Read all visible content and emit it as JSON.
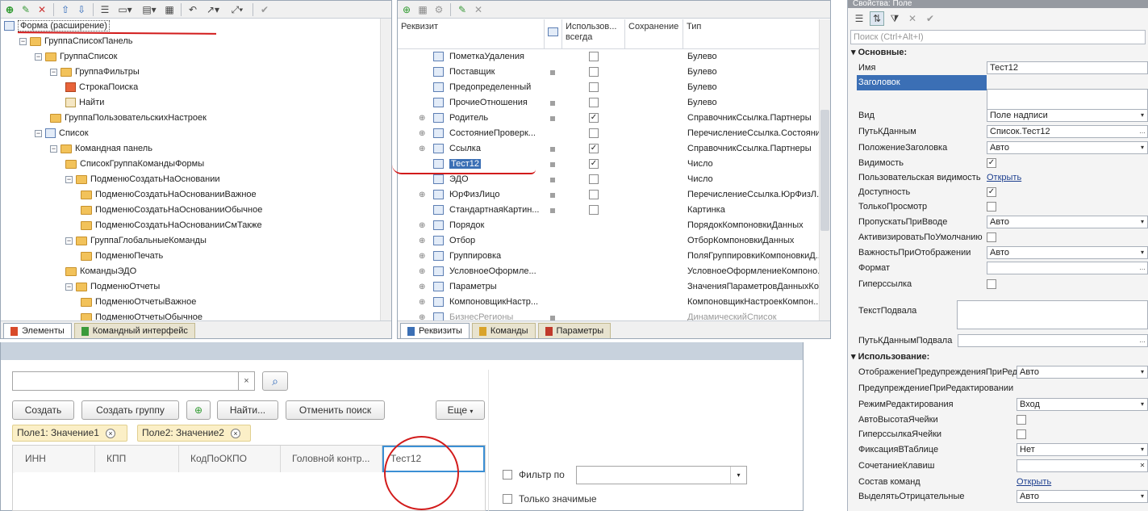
{
  "left_panel": {
    "tree": [
      {
        "label": "Форма (расширение)",
        "level": 0
      },
      {
        "label": "ГруппаСписокПанель",
        "level": 1
      },
      {
        "label": "ГруппаСписок",
        "level": 2
      },
      {
        "label": "ГруппаФильтры",
        "level": 3
      },
      {
        "label": "СтрокаПоиска",
        "level": 4
      },
      {
        "label": "Найти",
        "level": 4
      },
      {
        "label": "ГруппаПользовательскихНастроек",
        "level": 3
      },
      {
        "label": "Список",
        "level": 2
      },
      {
        "label": "Командная панель",
        "level": 3
      },
      {
        "label": "СписокГруппаКомандыФормы",
        "level": 4
      },
      {
        "label": "ПодменюСоздатьНаОсновании",
        "level": 4
      },
      {
        "label": "ПодменюСоздатьНаОснованииВажное",
        "level": 5
      },
      {
        "label": "ПодменюСоздатьНаОснованииОбычное",
        "level": 5
      },
      {
        "label": "ПодменюСоздатьНаОснованииСмТакже",
        "level": 5
      },
      {
        "label": "ГруппаГлобальныеКоманды",
        "level": 4
      },
      {
        "label": "ПодменюПечать",
        "level": 5
      },
      {
        "label": "КомандыЭДО",
        "level": 4
      },
      {
        "label": "ПодменюОтчеты",
        "level": 4
      },
      {
        "label": "ПодменюОтчетыВажное",
        "level": 5
      },
      {
        "label": "ПодменюОтчетыОбычное",
        "level": 5
      }
    ],
    "tabs": [
      "Элементы",
      "Командный интерфейс"
    ]
  },
  "middle_panel": {
    "headers": {
      "rekvizit": "Реквизит",
      "use_always": "Использов... всегда",
      "save": "Сохранение",
      "type": "Тип"
    },
    "rows": [
      {
        "name": "ПометкаУдаления",
        "dot": false,
        "check": false,
        "type": "Булево",
        "expand": false
      },
      {
        "name": "Поставщик",
        "dot": true,
        "check": false,
        "type": "Булево",
        "expand": false
      },
      {
        "name": "Предопределенный",
        "dot": false,
        "check": false,
        "type": "Булево",
        "expand": false
      },
      {
        "name": "ПрочиеОтношения",
        "dot": true,
        "check": false,
        "type": "Булево",
        "expand": false
      },
      {
        "name": "Родитель",
        "dot": true,
        "check": true,
        "type": "СправочникСсылка.Партнеры",
        "expand": true
      },
      {
        "name": "СостояниеПроверк...",
        "dot": false,
        "check": false,
        "type": "ПеречислениеСсылка.Состояни...",
        "expand": true
      },
      {
        "name": "Ссылка",
        "dot": true,
        "check": true,
        "type": "СправочникСсылка.Партнеры",
        "expand": true
      },
      {
        "name": "Тест12",
        "dot": true,
        "check": true,
        "type": "Число",
        "expand": false,
        "selected": true
      },
      {
        "name": "ЭДО",
        "dot": true,
        "check": false,
        "type": "Число",
        "expand": false
      },
      {
        "name": "ЮрФизЛицо",
        "dot": true,
        "check": false,
        "type": "ПеречислениеСсылка.ЮрФизЛ...",
        "expand": true
      },
      {
        "name": "СтандартнаяКартин...",
        "dot": true,
        "check": false,
        "type": "Картинка",
        "expand": false
      },
      {
        "name": "Порядок",
        "dot": false,
        "check": null,
        "type": "ПорядокКомпоновкиДанных",
        "expand": true
      },
      {
        "name": "Отбор",
        "dot": false,
        "check": null,
        "type": "ОтборКомпоновкиДанных",
        "expand": true
      },
      {
        "name": "Группировка",
        "dot": false,
        "check": null,
        "type": "ПоляГруппировкиКомпоновкиД...",
        "expand": true
      },
      {
        "name": "УсловноеОформле...",
        "dot": false,
        "check": null,
        "type": "УсловноеОформлениеКомпоно...",
        "expand": true
      },
      {
        "name": "Параметры",
        "dot": false,
        "check": null,
        "type": "ЗначенияПараметровДанныхКо...",
        "expand": true
      },
      {
        "name": "КомпоновщикНастр...",
        "dot": false,
        "check": null,
        "type": "КомпоновщикНастроекКомпон...",
        "expand": true
      },
      {
        "name": "БизнесРегионы",
        "dot": true,
        "check": null,
        "type": "ДинамическийСписок",
        "expand": true
      }
    ],
    "tabs": [
      "Реквизиты",
      "Команды",
      "Параметры"
    ]
  },
  "properties": {
    "title": "Свойства: Поле",
    "search_placeholder": "Поиск (Ctrl+Alt+I)",
    "section_main": "Основные:",
    "section_use": "Использование:",
    "main": [
      {
        "label": "Имя",
        "value": "Тест12",
        "kind": "text"
      },
      {
        "label": "Заголовок",
        "value": "",
        "kind": "textarea"
      },
      {
        "label": "Вид",
        "value": "Поле надписи",
        "kind": "select"
      },
      {
        "label": "ПутьКДанным",
        "value": "Список.Тест12",
        "kind": "button"
      },
      {
        "label": "ПоложениеЗаголовка",
        "value": "Авто",
        "kind": "select"
      },
      {
        "label": "Видимость",
        "value": true,
        "kind": "check"
      },
      {
        "label": "Пользовательская видимость",
        "value": "Открыть",
        "kind": "link"
      },
      {
        "label": "Доступность",
        "value": true,
        "kind": "check"
      },
      {
        "label": "ТолькоПросмотр",
        "value": false,
        "kind": "check"
      },
      {
        "label": "ПропускатьПриВводе",
        "value": "Авто",
        "kind": "select"
      },
      {
        "label": "АктивизироватьПоУмолчанию",
        "value": false,
        "kind": "check"
      },
      {
        "label": "ВажностьПриОтображении",
        "value": "Авто",
        "kind": "select"
      },
      {
        "label": "Формат",
        "value": "",
        "kind": "button"
      },
      {
        "label": "Гиперссылка",
        "value": false,
        "kind": "check"
      },
      {
        "label": "ТекстПодвала",
        "value": "",
        "kind": "textarea"
      },
      {
        "label": "ПутьКДаннымПодвала",
        "value": "",
        "kind": "button"
      }
    ],
    "use": [
      {
        "label": "ОтображениеПредупрежденияПриРед",
        "value": "Авто",
        "kind": "select"
      },
      {
        "label": "ПредупреждениеПриРедактировании",
        "value": "",
        "kind": "none"
      },
      {
        "label": "РежимРедактирования",
        "value": "Вход",
        "kind": "select"
      },
      {
        "label": "АвтоВысотаЯчейки",
        "value": false,
        "kind": "check"
      },
      {
        "label": "ГиперссылкаЯчейки",
        "value": false,
        "kind": "check"
      },
      {
        "label": "ФиксацияВТаблице",
        "value": "Нет",
        "kind": "select"
      },
      {
        "label": "СочетаниеКлавиш",
        "value": "",
        "kind": "clear"
      },
      {
        "label": "Состав команд",
        "value": "Открыть",
        "kind": "link"
      },
      {
        "label": "ВыделятьОтрицательные",
        "value": "Авто",
        "kind": "select"
      }
    ]
  },
  "preview": {
    "buttons": {
      "create": "Создать",
      "create_group": "Создать группу",
      "find": "Найти...",
      "cancel_search": "Отменить поиск",
      "more": "Еще"
    },
    "filters": [
      "Поле1: Значение1",
      "Поле2: Значение2"
    ],
    "columns": [
      "ИНН",
      "КПП",
      "КодПоОКПО",
      "Головной контр...",
      "Тест12"
    ],
    "filter_by": "Фильтр по",
    "only_significant": "Только значимые"
  },
  "colors": {
    "accent": "#3b6fb5",
    "annotation": "#d21b1b"
  }
}
